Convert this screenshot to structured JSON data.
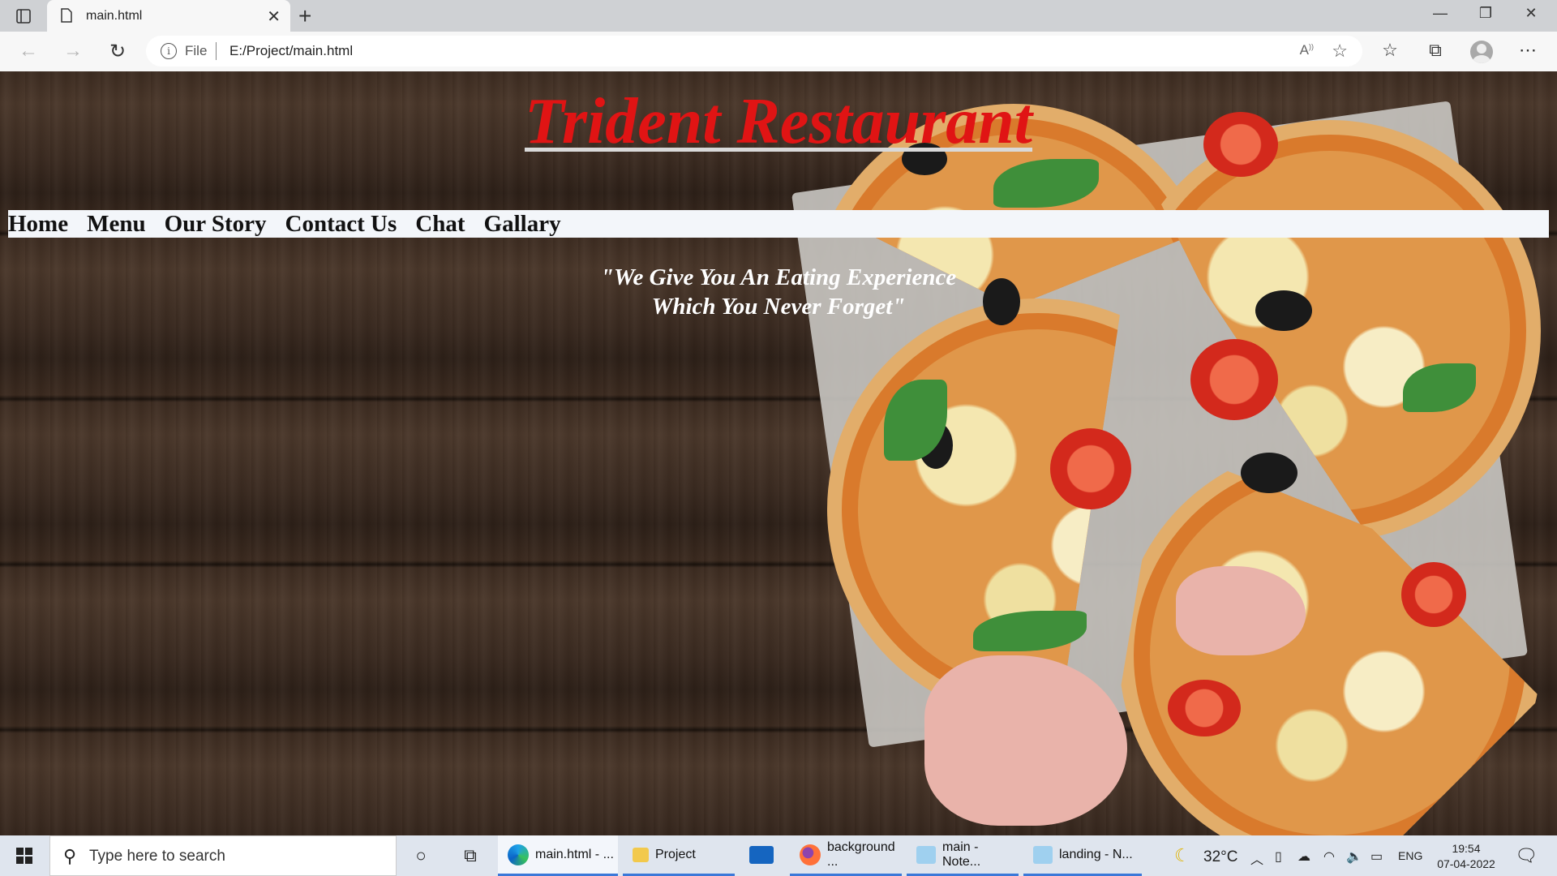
{
  "browser": {
    "tab_title": "main.html",
    "address_scheme_label": "File",
    "url": "E:/Project/main.html"
  },
  "page": {
    "title": "Trident Restaurant",
    "nav": [
      "Home",
      "Menu",
      "Our Story",
      "Contact Us",
      "Chat",
      "Gallary"
    ],
    "tagline_line1": "\"We Give You An Eating Experience",
    "tagline_line2": "Which You Never Forget\""
  },
  "taskbar": {
    "search_placeholder": "Type here to search",
    "apps": [
      {
        "label": "main.html - ...",
        "icon": "edge-icon",
        "active": true
      },
      {
        "label": "Project",
        "icon": "folder-icon",
        "active": false
      },
      {
        "label": "",
        "icon": "mail-icon",
        "active": false
      },
      {
        "label": "background ...",
        "icon": "firefox-icon",
        "active": false
      },
      {
        "label": "main - Note...",
        "icon": "notepad-icon",
        "active": false
      },
      {
        "label": "landing - N...",
        "icon": "notepad-icon",
        "active": false
      }
    ],
    "weather": "32°C",
    "language": "ENG",
    "time": "19:54",
    "date": "07-04-2022"
  },
  "colors": {
    "title_red": "#e01414",
    "nav_bg": "#f3f6fa",
    "taskbar_bg": "#dfe5ee",
    "active_underline": "#3b78d8"
  }
}
